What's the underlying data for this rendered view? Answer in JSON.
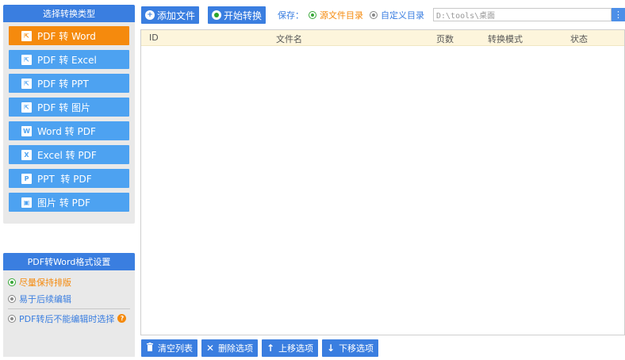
{
  "sidebar": {
    "header": "选择转换类型",
    "items": [
      {
        "label": "PDF 转 Word",
        "icon": "pdf-icon",
        "icon_char": "⇱",
        "active": true
      },
      {
        "label": "PDF 转 Excel",
        "icon": "pdf-icon",
        "icon_char": "⇱",
        "active": false
      },
      {
        "label": "PDF 转 PPT",
        "icon": "pdf-icon",
        "icon_char": "⇱",
        "active": false
      },
      {
        "label": "PDF 转 图片",
        "icon": "pdf-icon",
        "icon_char": "⇱",
        "active": false
      },
      {
        "label": "Word 转 PDF",
        "icon": "word-icon",
        "icon_char": "W",
        "active": false
      },
      {
        "label": "Excel 转 PDF",
        "icon": "excel-icon",
        "icon_char": "X",
        "active": false
      },
      {
        "label": "PPT  转 PDF",
        "icon": "ppt-icon",
        "icon_char": "P",
        "active": false
      },
      {
        "label": "图片 转 PDF",
        "icon": "image-icon",
        "icon_char": "▣",
        "active": false
      }
    ]
  },
  "settings": {
    "header": "PDF转Word格式设置",
    "options": [
      {
        "label": "尽量保持排版",
        "selected": true
      },
      {
        "label": "易于后续编辑",
        "selected": false
      },
      {
        "label": "PDF转后不能编辑时选择",
        "selected": false,
        "help": "?"
      }
    ]
  },
  "toolbar": {
    "add_file_label": "添加文件",
    "add_file_icon": "+",
    "start_label": "开始转换",
    "save_label": "保存：",
    "save_options": [
      "源文件目录",
      "自定义目录"
    ],
    "save_selected": 0,
    "path_value": "D:\\tools\\桌面",
    "path_button": "⋮"
  },
  "table": {
    "columns": [
      "ID",
      "文件名",
      "页数",
      "转换模式",
      "状态"
    ]
  },
  "bottom_buttons": [
    {
      "label": "清空列表",
      "icon": "trash-icon",
      "glyph": "🗑"
    },
    {
      "label": "删除选项",
      "icon": "close-icon",
      "glyph": "✕"
    },
    {
      "label": "上移选项",
      "icon": "arrow-up-icon",
      "glyph": "↑"
    },
    {
      "label": "下移选项",
      "icon": "arrow-down-icon",
      "glyph": "↓"
    }
  ],
  "colors": {
    "primary": "#3a7ee0",
    "button_blue": "#4da2f1",
    "active_orange": "#f58a0d",
    "radio_green": "#3aa83a",
    "table_header": "#fdf5dc"
  }
}
